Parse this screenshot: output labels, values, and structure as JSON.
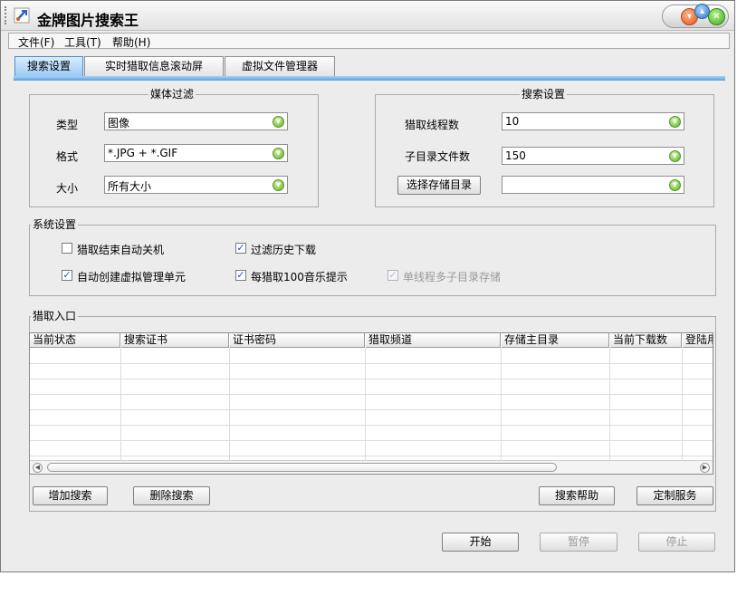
{
  "window": {
    "title": "金牌图片搜索王"
  },
  "menu": [
    "文件(F)",
    "工具(T)",
    "帮助(H)"
  ],
  "tabs": [
    "搜索设置",
    "实时猎取信息滚动屏",
    "虚拟文件管理器"
  ],
  "media_filter": {
    "legend": "媒体过滤",
    "type_label": "类型",
    "type_value": "图像",
    "format_label": "格式",
    "format_value": "*.JPG + *.GIF",
    "size_label": "大小",
    "size_value": "所有大小"
  },
  "search_settings": {
    "legend": "搜索设置",
    "threads_label": "猎取线程数",
    "threads_value": "10",
    "subdir_label": "子目录文件数",
    "subdir_value": "150",
    "choose_dir_button": "选择存储目录",
    "dir_value": ""
  },
  "system_settings": {
    "legend": "系统设置",
    "options": [
      {
        "label": "猎取结束自动关机",
        "checked": false,
        "enabled": true
      },
      {
        "label": "过滤历史下载",
        "checked": true,
        "enabled": true
      },
      {
        "label": "自动创建虚拟管理单元",
        "checked": true,
        "enabled": true
      },
      {
        "label": "每猎取100音乐提示",
        "checked": true,
        "enabled": true
      },
      {
        "label": "单线程多子目录存储",
        "checked": true,
        "enabled": false
      }
    ]
  },
  "entry": {
    "legend": "猎取入口",
    "columns": [
      "当前状态",
      "搜索证书",
      "证书密码",
      "猎取频道",
      "存储主目录",
      "当前下载数",
      "登陆用"
    ],
    "add_button": "增加搜索",
    "delete_button": "删除搜索",
    "help_button": "搜索帮助",
    "custom_button": "定制服务"
  },
  "actions": {
    "start": "开始",
    "pause": "暂停",
    "stop": "停止"
  },
  "colors": {
    "active_tab": "#9ccbf4",
    "tab_line": "#5c9fdc",
    "dropdown_button": "#5cad2a",
    "check_mark": "#1e56c9"
  }
}
